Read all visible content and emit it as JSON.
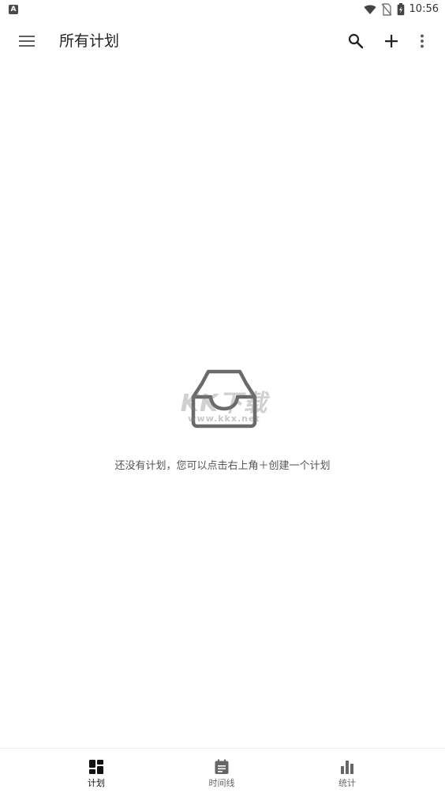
{
  "status_bar": {
    "time": "10:56",
    "left_icon": "A",
    "icons": [
      "wifi-icon",
      "no-sim-icon",
      "battery-charging-icon"
    ]
  },
  "app_bar": {
    "title": "所有计划",
    "icons": [
      "menu-icon",
      "search-icon",
      "add-icon",
      "more-vert-icon"
    ]
  },
  "empty_state": {
    "icon": "inbox-icon",
    "watermark": "KK下载",
    "watermark_sub": "www.kkx.net",
    "message": "还没有计划，您可以点击右上角＋创建一个计划"
  },
  "bottom_nav": {
    "items": [
      {
        "label": "计划",
        "icon": "dashboard-icon",
        "active": true
      },
      {
        "label": "时间线",
        "icon": "timeline-icon",
        "active": false
      },
      {
        "label": "统计",
        "icon": "bar-chart-icon",
        "active": false
      }
    ]
  },
  "colors": {
    "icon": "#333333",
    "text_primary": "#222222",
    "text_secondary": "#555555",
    "nav_inactive": "#666666",
    "inbox_stroke": "#6a6a6a"
  }
}
